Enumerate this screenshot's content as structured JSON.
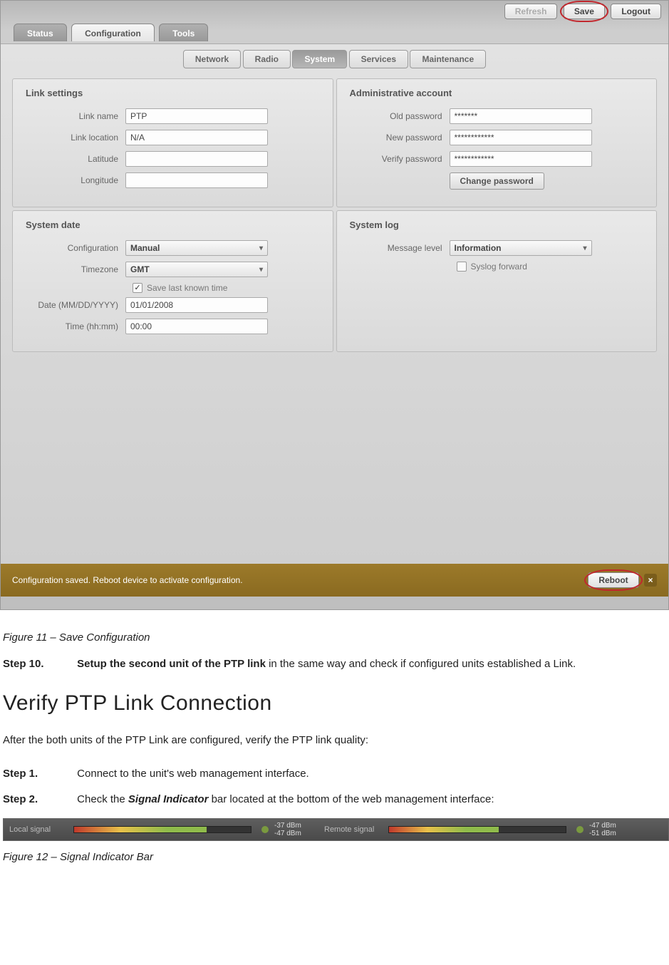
{
  "top_actions": {
    "refresh": "Refresh",
    "save": "Save",
    "logout": "Logout"
  },
  "tabs": {
    "main": [
      "Status",
      "Configuration",
      "Tools"
    ],
    "main_active": 1,
    "sub": [
      "Network",
      "Radio",
      "System",
      "Services",
      "Maintenance"
    ],
    "sub_active": 2
  },
  "panels": {
    "link_settings": {
      "title": "Link settings",
      "fields": {
        "link_name": {
          "label": "Link name",
          "value": "PTP"
        },
        "link_location": {
          "label": "Link location",
          "value": "N/A"
        },
        "latitude": {
          "label": "Latitude",
          "value": ""
        },
        "longitude": {
          "label": "Longitude",
          "value": ""
        }
      }
    },
    "admin_account": {
      "title": "Administrative account",
      "fields": {
        "old_password": {
          "label": "Old password",
          "value": "*******"
        },
        "new_password": {
          "label": "New password",
          "value": "************"
        },
        "verify_password": {
          "label": "Verify password",
          "value": "************"
        }
      },
      "button": "Change password"
    },
    "system_date": {
      "title": "System date",
      "fields": {
        "configuration": {
          "label": "Configuration",
          "value": "Manual"
        },
        "timezone": {
          "label": "Timezone",
          "value": "GMT"
        },
        "save_last": {
          "label": "Save last known time",
          "checked": true
        },
        "date": {
          "label": "Date (MM/DD/YYYY)",
          "value": "01/01/2008"
        },
        "time": {
          "label": "Time (hh:mm)",
          "value": "00:00"
        }
      }
    },
    "system_log": {
      "title": "System log",
      "fields": {
        "message_level": {
          "label": "Message level",
          "value": "Information"
        },
        "syslog_forward": {
          "label": "Syslog forward",
          "checked": false
        }
      }
    }
  },
  "status_bar": {
    "message": "Configuration saved. Reboot device to activate configuration.",
    "reboot": "Reboot"
  },
  "doc": {
    "fig11": "Figure 11 – Save Configuration",
    "step10_num": "Step 10.",
    "step10_bold": "Setup the second unit of the PTP link",
    "step10_rest": " in the same way and check if configured units established a Link.",
    "h2": "Verify PTP Link Connection",
    "intro": "After the both units of the PTP Link are configured, verify the PTP link quality:",
    "step1_num": "Step 1.",
    "step1_text": "Connect to the unit's web management interface.",
    "step2_num": "Step 2.",
    "step2_pre": "Check the ",
    "step2_ital": "Signal Indicator",
    "step2_post": " bar located at the bottom of the web management interface:",
    "fig12": "Figure 12 – Signal Indicator Bar"
  },
  "signal_bar": {
    "local": {
      "label": "Local signal",
      "v1": "-37 dBm",
      "v2": "-47 dBm",
      "fill": "75"
    },
    "remote": {
      "label": "Remote signal",
      "v1": "-47 dBm",
      "v2": "-51 dBm",
      "fill": "62"
    }
  }
}
